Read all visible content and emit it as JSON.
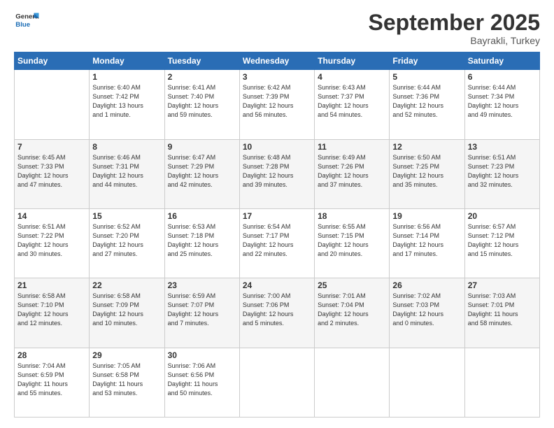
{
  "logo": {
    "line1": "General",
    "line2": "Blue"
  },
  "title": "September 2025",
  "subtitle": "Bayrakli, Turkey",
  "days_header": [
    "Sunday",
    "Monday",
    "Tuesday",
    "Wednesday",
    "Thursday",
    "Friday",
    "Saturday"
  ],
  "weeks": [
    [
      {
        "num": "",
        "info": ""
      },
      {
        "num": "1",
        "info": "Sunrise: 6:40 AM\nSunset: 7:42 PM\nDaylight: 13 hours\nand 1 minute."
      },
      {
        "num": "2",
        "info": "Sunrise: 6:41 AM\nSunset: 7:40 PM\nDaylight: 12 hours\nand 59 minutes."
      },
      {
        "num": "3",
        "info": "Sunrise: 6:42 AM\nSunset: 7:39 PM\nDaylight: 12 hours\nand 56 minutes."
      },
      {
        "num": "4",
        "info": "Sunrise: 6:43 AM\nSunset: 7:37 PM\nDaylight: 12 hours\nand 54 minutes."
      },
      {
        "num": "5",
        "info": "Sunrise: 6:44 AM\nSunset: 7:36 PM\nDaylight: 12 hours\nand 52 minutes."
      },
      {
        "num": "6",
        "info": "Sunrise: 6:44 AM\nSunset: 7:34 PM\nDaylight: 12 hours\nand 49 minutes."
      }
    ],
    [
      {
        "num": "7",
        "info": "Sunrise: 6:45 AM\nSunset: 7:33 PM\nDaylight: 12 hours\nand 47 minutes."
      },
      {
        "num": "8",
        "info": "Sunrise: 6:46 AM\nSunset: 7:31 PM\nDaylight: 12 hours\nand 44 minutes."
      },
      {
        "num": "9",
        "info": "Sunrise: 6:47 AM\nSunset: 7:29 PM\nDaylight: 12 hours\nand 42 minutes."
      },
      {
        "num": "10",
        "info": "Sunrise: 6:48 AM\nSunset: 7:28 PM\nDaylight: 12 hours\nand 39 minutes."
      },
      {
        "num": "11",
        "info": "Sunrise: 6:49 AM\nSunset: 7:26 PM\nDaylight: 12 hours\nand 37 minutes."
      },
      {
        "num": "12",
        "info": "Sunrise: 6:50 AM\nSunset: 7:25 PM\nDaylight: 12 hours\nand 35 minutes."
      },
      {
        "num": "13",
        "info": "Sunrise: 6:51 AM\nSunset: 7:23 PM\nDaylight: 12 hours\nand 32 minutes."
      }
    ],
    [
      {
        "num": "14",
        "info": "Sunrise: 6:51 AM\nSunset: 7:22 PM\nDaylight: 12 hours\nand 30 minutes."
      },
      {
        "num": "15",
        "info": "Sunrise: 6:52 AM\nSunset: 7:20 PM\nDaylight: 12 hours\nand 27 minutes."
      },
      {
        "num": "16",
        "info": "Sunrise: 6:53 AM\nSunset: 7:18 PM\nDaylight: 12 hours\nand 25 minutes."
      },
      {
        "num": "17",
        "info": "Sunrise: 6:54 AM\nSunset: 7:17 PM\nDaylight: 12 hours\nand 22 minutes."
      },
      {
        "num": "18",
        "info": "Sunrise: 6:55 AM\nSunset: 7:15 PM\nDaylight: 12 hours\nand 20 minutes."
      },
      {
        "num": "19",
        "info": "Sunrise: 6:56 AM\nSunset: 7:14 PM\nDaylight: 12 hours\nand 17 minutes."
      },
      {
        "num": "20",
        "info": "Sunrise: 6:57 AM\nSunset: 7:12 PM\nDaylight: 12 hours\nand 15 minutes."
      }
    ],
    [
      {
        "num": "21",
        "info": "Sunrise: 6:58 AM\nSunset: 7:10 PM\nDaylight: 12 hours\nand 12 minutes."
      },
      {
        "num": "22",
        "info": "Sunrise: 6:58 AM\nSunset: 7:09 PM\nDaylight: 12 hours\nand 10 minutes."
      },
      {
        "num": "23",
        "info": "Sunrise: 6:59 AM\nSunset: 7:07 PM\nDaylight: 12 hours\nand 7 minutes."
      },
      {
        "num": "24",
        "info": "Sunrise: 7:00 AM\nSunset: 7:06 PM\nDaylight: 12 hours\nand 5 minutes."
      },
      {
        "num": "25",
        "info": "Sunrise: 7:01 AM\nSunset: 7:04 PM\nDaylight: 12 hours\nand 2 minutes."
      },
      {
        "num": "26",
        "info": "Sunrise: 7:02 AM\nSunset: 7:03 PM\nDaylight: 12 hours\nand 0 minutes."
      },
      {
        "num": "27",
        "info": "Sunrise: 7:03 AM\nSunset: 7:01 PM\nDaylight: 11 hours\nand 58 minutes."
      }
    ],
    [
      {
        "num": "28",
        "info": "Sunrise: 7:04 AM\nSunset: 6:59 PM\nDaylight: 11 hours\nand 55 minutes."
      },
      {
        "num": "29",
        "info": "Sunrise: 7:05 AM\nSunset: 6:58 PM\nDaylight: 11 hours\nand 53 minutes."
      },
      {
        "num": "30",
        "info": "Sunrise: 7:06 AM\nSunset: 6:56 PM\nDaylight: 11 hours\nand 50 minutes."
      },
      {
        "num": "",
        "info": ""
      },
      {
        "num": "",
        "info": ""
      },
      {
        "num": "",
        "info": ""
      },
      {
        "num": "",
        "info": ""
      }
    ]
  ]
}
